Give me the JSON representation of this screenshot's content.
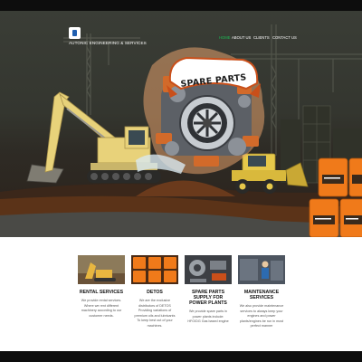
{
  "header": {
    "brand": "AUTONIC ENGINEERING & SERVICES",
    "nav": [
      "HOME",
      "ABOUT US",
      "CLIENTS",
      "CONTACT US"
    ]
  },
  "hero": {
    "banner_text": "SPARE PARTS",
    "image_alt": "construction machinery, engine spare parts and oil drums"
  },
  "services": [
    {
      "title": "RENTAL SERVICES",
      "desc": [
        "We provide rental services.",
        "Where we rent different",
        "machinery according to our",
        "customer needs."
      ],
      "image_alt": "excavator at construction site"
    },
    {
      "title": "DETOS",
      "desc": [
        "We are the exclusive",
        "distributors of DETOS",
        "Providing variations of",
        "premium oils and lubricants",
        "To keep best out of your",
        "machines."
      ],
      "image_alt": "orange lubricant drums"
    },
    {
      "title": "SPARE PARTS SUPPLY FOR POWER PLANTS",
      "desc": [
        "We provide spare parts in",
        "power plants include:",
        "HFO/DG Gas based engine"
      ],
      "image_alt": "engine spare parts"
    },
    {
      "title": "MAINTENANCE SERVICES",
      "desc": [
        "We also provide maintenance",
        "services to always keep your",
        "engines and power",
        "plants/engines be run in most",
        "perfect manner"
      ],
      "image_alt": "engineer doing maintenance"
    }
  ],
  "colors": {
    "accent_green": "#1db954",
    "logo_blue": "#1f5fb0",
    "page_dark": "#0d0d0d",
    "hero_dark": "#34362f",
    "excavator_yellow": "#e8d27a",
    "drum_orange": "#f07a1a"
  }
}
